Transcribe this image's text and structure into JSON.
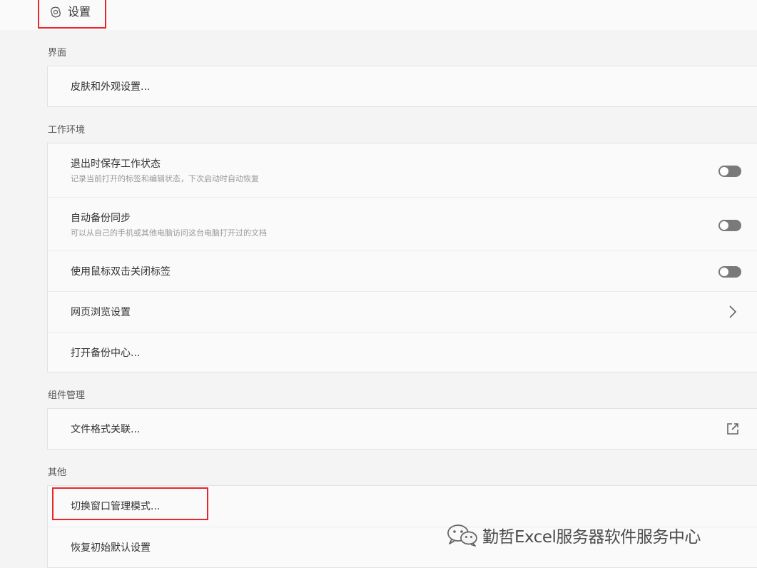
{
  "header": {
    "title": "设置",
    "icon": "gear-icon"
  },
  "sections": {
    "interface": {
      "label": "界面",
      "items": [
        {
          "title": "皮肤和外观设置..."
        }
      ]
    },
    "workspace": {
      "label": "工作环境",
      "items": [
        {
          "title": "退出时保存工作状态",
          "subtitle": "记录当前打开的标签和编辑状态，下次启动时自动恢复",
          "control": "toggle",
          "state": "off"
        },
        {
          "title": "自动备份同步",
          "subtitle": "可以从自己的手机或其他电脑访问这台电脑打开过的文档",
          "control": "toggle",
          "state": "off"
        },
        {
          "title": "使用鼠标双击关闭标签",
          "control": "toggle",
          "state": "off"
        },
        {
          "title": "网页浏览设置",
          "control": "chevron-right-icon"
        },
        {
          "title": "打开备份中心..."
        }
      ]
    },
    "components": {
      "label": "组件管理",
      "items": [
        {
          "title": "文件格式关联...",
          "control": "external-link-icon"
        }
      ]
    },
    "other": {
      "label": "其他",
      "items": [
        {
          "title": "切换窗口管理模式..."
        },
        {
          "title": "恢复初始默认设置"
        }
      ]
    }
  },
  "watermark": {
    "text": "勤哲Excel服务器软件服务中心",
    "icon": "wechat-icon"
  },
  "colors": {
    "highlight": "#e8262b",
    "toggle_off": "#7a7a7a",
    "background": "#f4f4f4",
    "card": "#fafafa"
  }
}
